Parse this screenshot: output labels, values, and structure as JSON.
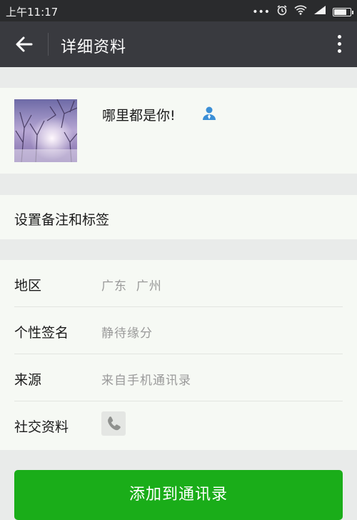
{
  "statusbar": {
    "time": "上午11:17"
  },
  "titlebar": {
    "title": "详细资料"
  },
  "profile": {
    "nickname": "哪里都是你!"
  },
  "remark": {
    "label": "设置备注和标签"
  },
  "details": {
    "region": {
      "label": "地区",
      "value": "广东  广州"
    },
    "signature": {
      "label": "个性签名",
      "value": "静待缘分"
    },
    "source": {
      "label": "来源",
      "value": "来自手机通讯录"
    },
    "social": {
      "label": "社交资料"
    }
  },
  "actions": {
    "add_label": "添加到通讯录"
  },
  "colors": {
    "primary_button": "#1aad19",
    "titlebar": "#393a3f",
    "statusbar": "#2a2b2d",
    "gender_icon": "#3b8fd6"
  },
  "icons": [
    "back-arrow-icon",
    "more-dots-icon",
    "male-gender-icon",
    "phone-icon",
    "wifi-icon",
    "alarm-icon",
    "signal-icon",
    "battery-icon"
  ]
}
